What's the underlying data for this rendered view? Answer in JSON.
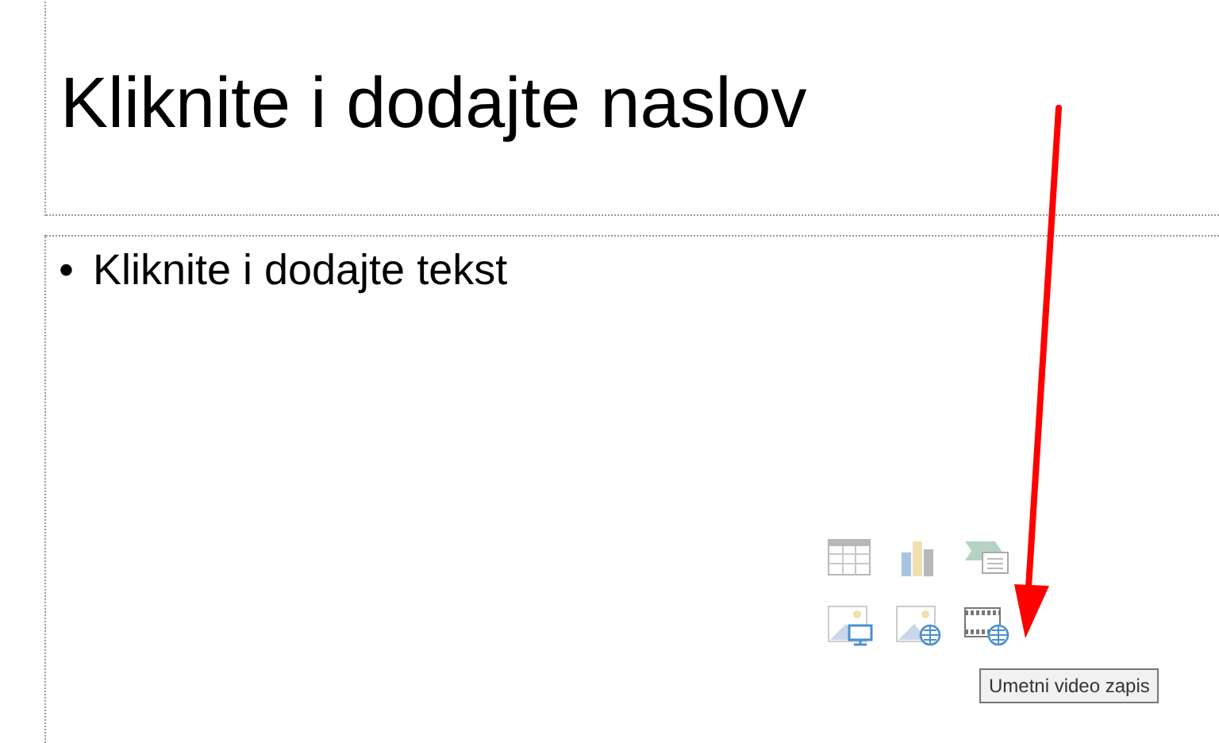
{
  "title_placeholder": {
    "text": "Kliknite i dodajte naslov"
  },
  "content_placeholder": {
    "bullet": "•",
    "text": "Kliknite i dodajte tekst",
    "insert_icons": [
      {
        "kind": "table"
      },
      {
        "kind": "chart"
      },
      {
        "kind": "smartart"
      },
      {
        "kind": "picture"
      },
      {
        "kind": "online-picture"
      },
      {
        "kind": "video"
      }
    ]
  },
  "tooltip": {
    "text": "Umetni video zapis"
  }
}
